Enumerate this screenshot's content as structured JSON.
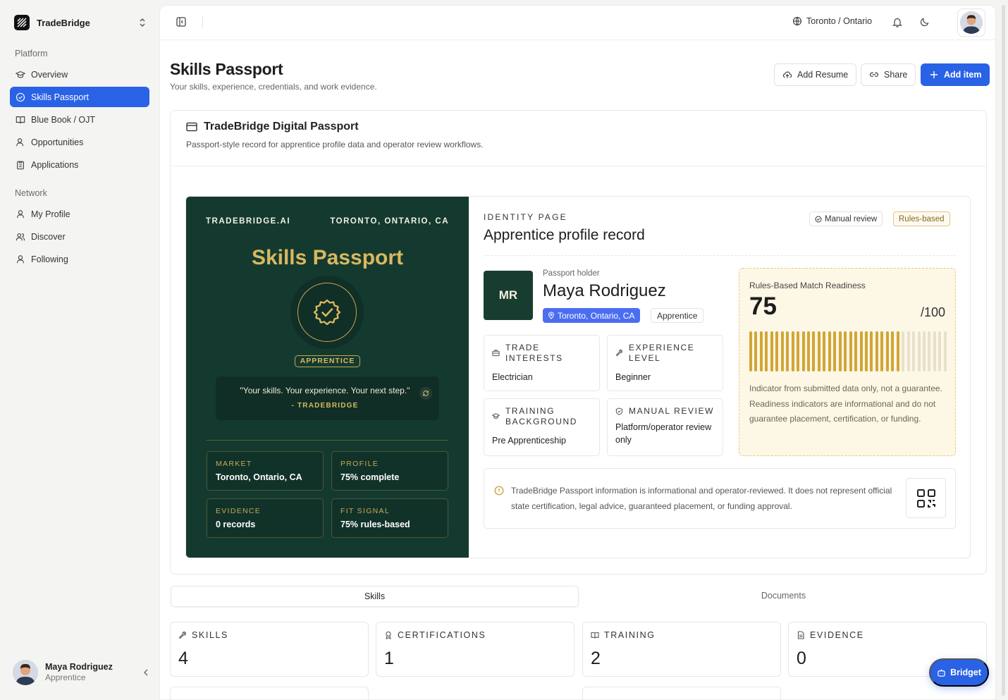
{
  "app": {
    "name": "TradeBridge"
  },
  "sidebar": {
    "sections": [
      {
        "title": "Platform"
      },
      {
        "title": "Network"
      }
    ],
    "platform_items": [
      {
        "label": "Overview",
        "icon": "graduation-cap-icon"
      },
      {
        "label": "Skills Passport",
        "icon": "badge-check-icon",
        "active": true
      },
      {
        "label": "Blue Book / OJT",
        "icon": "book-open-icon"
      },
      {
        "label": "Opportunities",
        "icon": "user-search-icon"
      },
      {
        "label": "Applications",
        "icon": "clipboard-icon"
      }
    ],
    "network_items": [
      {
        "label": "My Profile",
        "icon": "user-icon"
      },
      {
        "label": "Discover",
        "icon": "users-icon"
      },
      {
        "label": "Following",
        "icon": "user-icon"
      }
    ],
    "user": {
      "name": "Maya Rodriguez",
      "role": "Apprentice"
    }
  },
  "topbar": {
    "location": "Toronto / Ontario"
  },
  "page": {
    "title": "Skills Passport",
    "subtitle": "Your skills, experience, credentials, and work evidence.",
    "actions": {
      "add_resume": "Add Resume",
      "share": "Share",
      "add_item": "Add item"
    }
  },
  "passport_card": {
    "title": "TradeBridge Digital Passport",
    "subtitle": "Passport-style record for apprentice profile data and operator review workflows."
  },
  "passport": {
    "issuer": "TRADEBRIDGE.AI",
    "location": "TORONTO, ONTARIO, CA",
    "title": "Skills Passport",
    "badge": "APPRENTICE",
    "quote": "\"Your skills. Your experience. Your next step.\"",
    "quote_by": "- TRADEBRIDGE",
    "stats": [
      {
        "label": "MARKET",
        "value": "Toronto, Ontario, CA"
      },
      {
        "label": "PROFILE",
        "value": "75% complete"
      },
      {
        "label": "EVIDENCE",
        "value": "0 records"
      },
      {
        "label": "FIT SIGNAL",
        "value": "75% rules-based"
      }
    ],
    "colors": {
      "background": "#143a2f",
      "gold": "#d9b860"
    }
  },
  "identity": {
    "eyebrow": "IDENTITY PAGE",
    "title": "Apprentice profile record",
    "pills": {
      "manual": "Manual review",
      "rules": "Rules-based"
    },
    "initials": "MR",
    "holder_label": "Passport holder",
    "holder_name": "Maya Rodriguez",
    "holder_location": "Toronto, Ontario, CA",
    "holder_role": "Apprentice",
    "fields": [
      {
        "label": "TRADE INTERESTS",
        "value": "Electrician",
        "icon": "briefcase-icon"
      },
      {
        "label": "EXPERIENCE LEVEL",
        "value": "Beginner",
        "icon": "wrench-icon"
      },
      {
        "label": "TRAINING BACKGROUND",
        "value": "Pre Apprenticeship",
        "icon": "graduation-cap-icon"
      },
      {
        "label": "MANUAL REVIEW",
        "value": "Platform/operator review only",
        "icon": "shield-check-icon"
      }
    ]
  },
  "readiness": {
    "title": "Rules-Based Match Readiness",
    "score": "75",
    "out_of": "/100",
    "fraction": 0.75,
    "note": "Indicator from submitted data only, not a guarantee. Readiness indicators are informational and do not guarantee placement, certification, or funding.",
    "color": "#d2a537"
  },
  "disclaimer": {
    "text": "TradeBridge Passport information is informational and operator-reviewed. It does not represent official state certification, legal advice, guaranteed placement, or funding approval."
  },
  "tabs": [
    {
      "label": "Skills"
    },
    {
      "label": "Documents"
    }
  ],
  "summary": [
    {
      "label": "SKILLS",
      "value": "4",
      "icon": "wrench-icon"
    },
    {
      "label": "CERTIFICATIONS",
      "value": "1",
      "icon": "award-icon"
    },
    {
      "label": "TRAINING",
      "value": "2",
      "icon": "book-open-icon"
    },
    {
      "label": "EVIDENCE",
      "value": "0",
      "icon": "file-text-icon"
    }
  ],
  "assistant": {
    "label": "Bridget"
  }
}
